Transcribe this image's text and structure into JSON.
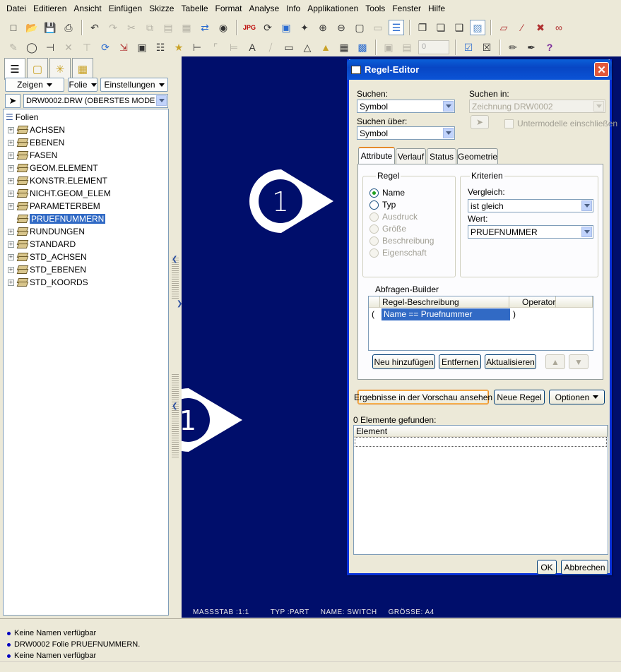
{
  "menu": [
    "Datei",
    "Editieren",
    "Ansicht",
    "Einfügen",
    "Skizze",
    "Tabelle",
    "Format",
    "Analyse",
    "Info",
    "Applikationen",
    "Tools",
    "Fenster",
    "Hilfe"
  ],
  "toolbar": {
    "jpg_label": "JPG",
    "scale_field_value": "0"
  },
  "left_panel": {
    "buttons": {
      "show": "Zeigen",
      "sheet": "Folie",
      "settings": "Einstellungen"
    },
    "model_selector": "DRW0002.DRW (OBERSTES MODE",
    "tree_root": "Folien",
    "tree_items": [
      "ACHSEN",
      "EBENEN",
      "FASEN",
      "GEOM.ELEMENT",
      "KONSTR.ELEMENT",
      "NICHT.GEOM_ELEM",
      "PARAMETERBEM",
      "PRUEFNUMMERN",
      "RUNDUNGEN",
      "STANDARD",
      "STD_ACHSEN",
      "STD_EBENEN",
      "STD_KOORDS"
    ],
    "selected_item": "PRUEFNUMMERN"
  },
  "canvas": {
    "balloon_number": "1",
    "footer": {
      "scale": "MASSSTAB :1:1",
      "type": "TYP :PART",
      "name": "NAME: SWITCH",
      "size": "GRÖSSE: A4"
    }
  },
  "dialog": {
    "title": "Regel-Editor",
    "search_label": "Suchen:",
    "search_value": "Symbol",
    "search_in_label": "Suchen in:",
    "search_in_value": "Zeichnung DRW0002",
    "search_over_label": "Suchen über:",
    "search_over_value": "Symbol",
    "submodels_label": "Untermodelle einschließen",
    "tabs": [
      "Attribute",
      "Verlauf",
      "Status",
      "Geometrie"
    ],
    "rule_group": "Regel",
    "rule_options": [
      {
        "label": "Name",
        "state": "selected"
      },
      {
        "label": "Typ",
        "state": "enabled"
      },
      {
        "label": "Ausdruck",
        "state": "disabled"
      },
      {
        "label": "Größe",
        "state": "disabled"
      },
      {
        "label": "Beschreibung",
        "state": "disabled"
      },
      {
        "label": "Eigenschaft",
        "state": "disabled"
      }
    ],
    "criteria_group": "Kriterien",
    "compare_label": "Vergleich:",
    "compare_value": "ist gleich",
    "value_label": "Wert:",
    "value_value": "PRUEFNUMMER",
    "query_builder_label": "Abfragen-Builder",
    "query_columns": {
      "description": "Regel-Beschreibung",
      "operator": "Operator"
    },
    "query_row": {
      "open": "(",
      "rule": "Name  ==  Pruefnummer",
      "close": ")"
    },
    "buttons": {
      "add": "Neu hinzufügen",
      "remove": "Entfernen",
      "update": "Aktualisieren",
      "preview": "Ergebnisse in der Vorschau ansehen",
      "new_rule": "Neue Regel",
      "options": "Optionen",
      "ok": "OK",
      "cancel": "Abbrechen"
    },
    "found_label": "0 Elemente gefunden:",
    "result_column": "Element"
  },
  "messages": [
    "Keine Namen verfügbar",
    "DRW0002 Folie PRUEFNUMMERN.",
    "Keine Namen verfügbar"
  ],
  "colors": {
    "canvas_bg": "#000e6b",
    "selection": "#316ac5",
    "title_bar": "#0846c4"
  }
}
